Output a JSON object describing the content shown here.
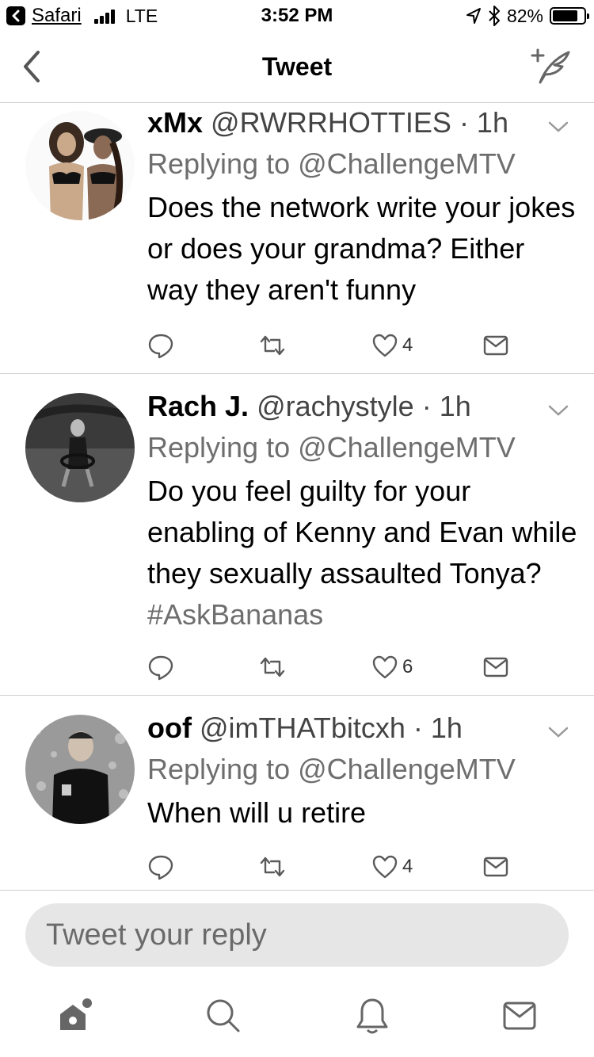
{
  "status_bar": {
    "app_back_label": "Safari",
    "network": "LTE",
    "time": "3:52 PM",
    "battery_percent": "82%",
    "battery_level": 0.82,
    "icons": [
      "back-arrow-icon",
      "signal-icon",
      "location-icon",
      "bluetooth-icon",
      "battery-icon"
    ]
  },
  "nav": {
    "title": "Tweet",
    "icons": [
      "chevron-left-icon",
      "compose-icon"
    ]
  },
  "tweets": [
    {
      "name": "xMx",
      "handle": "@RWRRHOTTIES",
      "time": "· 1h",
      "replying_to": "Replying to @ChallengeMTV",
      "text": "Does the network write your jokes or does your grandma? Either way they aren't funny",
      "hashtag": "",
      "likes": "4"
    },
    {
      "name": "Rach J.",
      "handle": "@rachystyle",
      "time": "· 1h",
      "replying_to": "Replying to @ChallengeMTV",
      "text": "Do you feel guilty for your enabling of Kenny and Evan while they sexually assaulted Tonya? ",
      "hashtag": "#AskBananas",
      "likes": "6"
    },
    {
      "name": "oof",
      "handle": "@imTHATbitcxh",
      "time": "· 1h",
      "replying_to": "Replying to @ChallengeMTV",
      "text": "When will u retire",
      "hashtag": "",
      "likes": "4"
    }
  ],
  "reply_box": {
    "placeholder": "Tweet your reply"
  },
  "tab_bar": {
    "icons": [
      "home-icon",
      "search-icon",
      "notifications-icon",
      "messages-icon"
    ]
  },
  "colors": {
    "divider": "#cfcfcf",
    "secondary_text": "#6e6e6e",
    "reply_box_bg": "#e6e6e6"
  }
}
